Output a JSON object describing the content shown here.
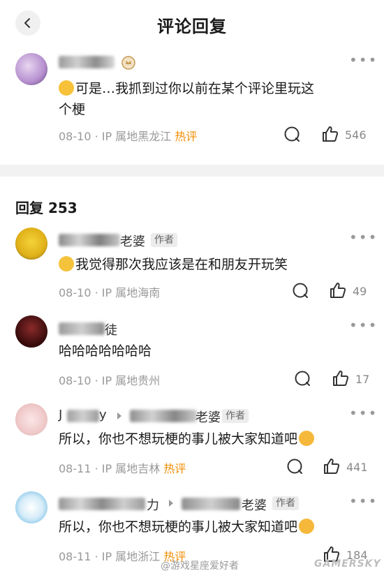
{
  "header": {
    "title": "评论回复"
  },
  "main_comment": {
    "text_line1": "可是…我抓到过你以前在某个评论里玩这",
    "text_line2": "个梗",
    "meta": "08-10 · IP 属地黑龙江",
    "hot": "热评",
    "likes": "546"
  },
  "replies_header": {
    "label": "回复 253"
  },
  "replies": [
    {
      "name_suffix": "老婆",
      "tag": "作者",
      "text": "我觉得那次我应该是在和朋友开玩笑",
      "meta": "08-10 · IP 属地海南",
      "hot": "",
      "likes": "49"
    },
    {
      "name_suffix": "徒",
      "tag": "",
      "text": "哈哈哈哈哈哈哈",
      "meta": "08-10 · IP 属地贵州",
      "hot": "",
      "likes": "17"
    },
    {
      "name_prefix": "J",
      "name_mid": "y",
      "name_suffix": "老婆",
      "tag": "作者",
      "text": "所以，你也不想玩梗的事儿被大家知道吧",
      "meta": "08-11 · IP 属地吉林",
      "hot": "热评",
      "likes": "441"
    },
    {
      "name_mid": "力",
      "name_suffix": "老婆",
      "tag": "作者",
      "text": "所以，你也不想玩梗的事儿被大家知道吧",
      "meta": "08-11 · IP 属地浙江",
      "hot": "热评",
      "likes": "184"
    }
  ],
  "watermark": {
    "weibo": "@游戏星座爱好者",
    "brand": "GAMERSKY"
  },
  "colors": {
    "hot": "#f08c00",
    "meta": "#999999",
    "band": "#f2f2f2"
  },
  "icons": [
    "chevron-left-icon",
    "comment-bubble-icon",
    "thumb-up-icon",
    "more-dots-icon",
    "vip-badge-icon"
  ]
}
